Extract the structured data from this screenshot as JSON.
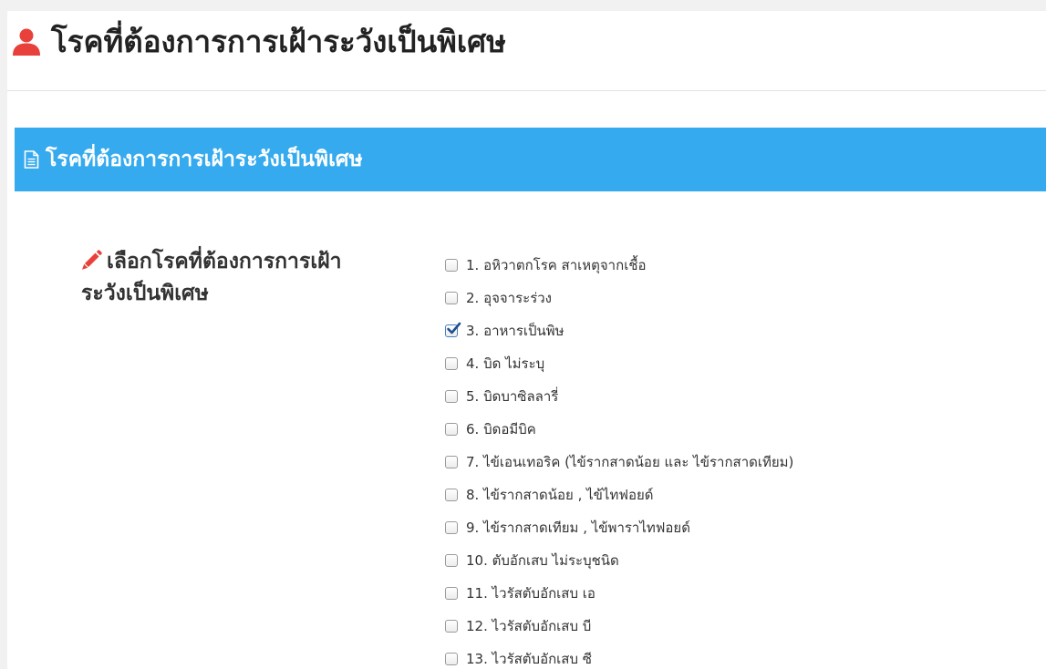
{
  "header": {
    "title": "โรคที่ต้องการการเฝ้าระวังเป็นพิเศษ",
    "icon": "user-icon",
    "icon_color": "#e8413c"
  },
  "panel": {
    "heading": "โรคที่ต้องการการเฝ้าระวังเป็นพิเศษ",
    "heading_icon": "document-icon",
    "heading_bg": "#35aaee"
  },
  "field": {
    "label": "เลือกโรคที่ต้องการการเฝ้าระวังเป็นพิเศษ",
    "label_icon": "pencil-icon",
    "label_icon_color": "#e8413c"
  },
  "options": [
    {
      "label": "1. อหิวาตกโรค สาเหตุจากเชื้อ",
      "checked": false
    },
    {
      "label": "2. อุจจาระร่วง",
      "checked": false
    },
    {
      "label": "3. อาหารเป็นพิษ",
      "checked": true
    },
    {
      "label": "4. บิด ไม่ระบุ",
      "checked": false
    },
    {
      "label": "5. บิดบาซิลลารี่",
      "checked": false
    },
    {
      "label": "6. บิดอมีบิค",
      "checked": false
    },
    {
      "label": "7. ไข้เอนเทอริค (ไข้รากสาดน้อย และ ไข้รากสาดเทียม)",
      "checked": false
    },
    {
      "label": "8. ไข้รากสาดน้อย , ไข้ไทฟอยด์",
      "checked": false
    },
    {
      "label": "9. ไข้รากสาดเทียม , ไข้พาราไทฟอยด์",
      "checked": false
    },
    {
      "label": "10. ตับอักเสบ ไม่ระบุชนิด",
      "checked": false
    },
    {
      "label": "11. ไวรัสตับอักเสบ เอ",
      "checked": false
    },
    {
      "label": "12. ไวรัสตับอักเสบ บี",
      "checked": false
    },
    {
      "label": "13. ไวรัสตับอักเสบ ซี",
      "checked": false
    }
  ]
}
